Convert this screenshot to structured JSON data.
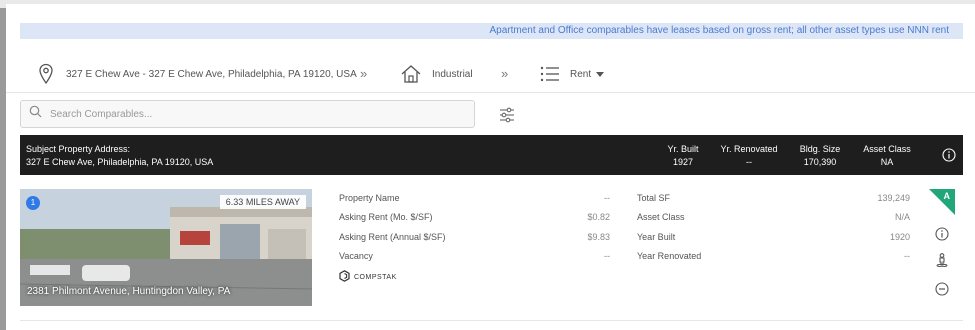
{
  "banner": {
    "text": "Apartment and Office comparables have leases based on gross rent; all other asset types use NNN rent"
  },
  "breadcrumb": {
    "address": "327 E Chew Ave - 327 E Chew Ave, Philadelphia, PA 19120, USA",
    "separator": "»",
    "property_type": "Industrial",
    "mode": "Rent",
    "icons": [
      "location-pin-icon",
      "home-icon",
      "list-icon",
      "caret-down-icon"
    ]
  },
  "search": {
    "placeholder": "Search Comparables..."
  },
  "subject": {
    "heading": "Subject Property Address:",
    "address": "327 E Chew Ave, Philadelphia, PA 19120, USA",
    "stats": [
      {
        "label": "Yr. Built",
        "value": "1927"
      },
      {
        "label": "Yr. Renovated",
        "value": "--"
      },
      {
        "label": "Bldg. Size",
        "value": "170,390"
      },
      {
        "label": "Asset Class",
        "value": "NA"
      }
    ]
  },
  "comparable": {
    "index": "1",
    "distance": "6.33 MILES AWAY",
    "address": "2381 Philmont Avenue, Huntingdon Valley, PA",
    "left_fields": [
      {
        "label": "Property Name",
        "value": "--"
      },
      {
        "label": "Asking Rent (Mo. $/SF)",
        "value": "$0.82"
      },
      {
        "label": "Asking Rent (Annual $/SF)",
        "value": "$9.83"
      },
      {
        "label": "Vacancy",
        "value": "--"
      }
    ],
    "right_fields": [
      {
        "label": "Total SF",
        "value": "139,249"
      },
      {
        "label": "Asset Class",
        "value": "N/A"
      },
      {
        "label": "Year Built",
        "value": "1920"
      },
      {
        "label": "Year Renovated",
        "value": "--"
      }
    ],
    "source": "COMPSTAK",
    "grade": "A",
    "grade_color": "#21a67a"
  },
  "colors": {
    "accent_blue": "#2f7ae5",
    "banner_bg": "#dde6f6",
    "banner_text": "#4a7bd0",
    "subject_bg": "#1e1e1e"
  }
}
